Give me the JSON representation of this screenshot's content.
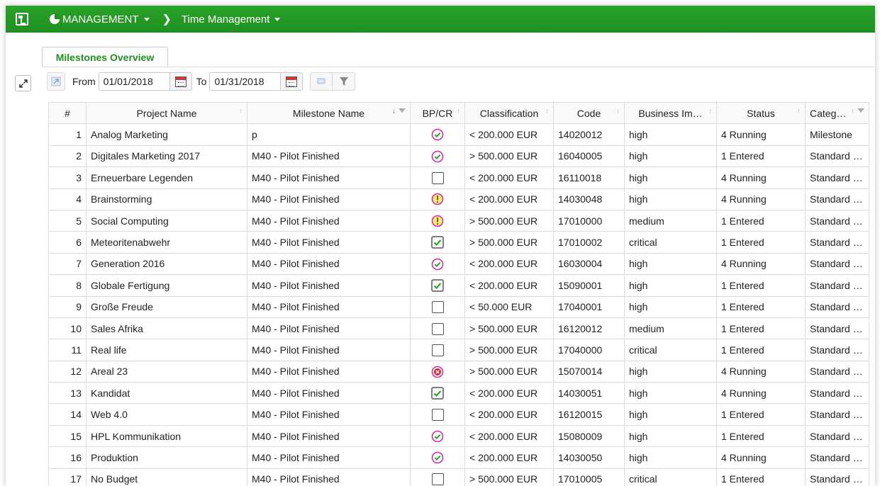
{
  "nav": {
    "management_label": "MANAGEMENT",
    "time_management_label": "Time Management"
  },
  "tab": {
    "label": "Milestones Overview"
  },
  "toolbar": {
    "from_label": "From",
    "from_value": "01/01/2018",
    "to_label": "To",
    "to_value": "01/31/2018"
  },
  "colors": {
    "accent": "#1f8f1f",
    "ok": "#d42ea6",
    "check": "#2aa52a",
    "warn": "#e0b400",
    "error": "#d42020"
  },
  "table": {
    "columns": [
      "#",
      "Project Name",
      "Milestone Name",
      "BP/CR",
      "Classification",
      "Code",
      "Business Im…",
      "Status",
      "Categ…"
    ],
    "rows": [
      {
        "n": "1",
        "project": "Analog Marketing",
        "milestone": "p",
        "bpcr": "circle-check",
        "class": "< 200.000 EUR",
        "code": "14020012",
        "impact": "high",
        "status": "4 Running",
        "cat": "Milestone"
      },
      {
        "n": "2",
        "project": "Digitales Marketing 2017",
        "milestone": "M40 - Pilot Finished",
        "bpcr": "circle-check",
        "class": "> 500.000 EUR",
        "code": "16040005",
        "impact": "high",
        "status": "1 Entered",
        "cat": "Standard …"
      },
      {
        "n": "3",
        "project": "Erneuerbare Legenden",
        "milestone": "M40 - Pilot Finished",
        "bpcr": "empty",
        "class": "< 200.000 EUR",
        "code": "16110018",
        "impact": "high",
        "status": "4 Running",
        "cat": "Standard …"
      },
      {
        "n": "4",
        "project": "Brainstorming",
        "milestone": "M40 - Pilot Finished",
        "bpcr": "warning",
        "class": "< 200.000 EUR",
        "code": "14030048",
        "impact": "high",
        "status": "4 Running",
        "cat": "Standard …"
      },
      {
        "n": "5",
        "project": "Social Computing",
        "milestone": "M40 - Pilot Finished",
        "bpcr": "warning",
        "class": "> 500.000 EUR",
        "code": "17010000",
        "impact": "medium",
        "status": "1 Entered",
        "cat": "Standard …"
      },
      {
        "n": "6",
        "project": "Meteoritenabwehr",
        "milestone": "M40 - Pilot Finished",
        "bpcr": "checkbox",
        "class": "> 500.000 EUR",
        "code": "17010002",
        "impact": "critical",
        "status": "1 Entered",
        "cat": "Standard …"
      },
      {
        "n": "7",
        "project": "Generation 2016",
        "milestone": "M40 - Pilot Finished",
        "bpcr": "circle-check",
        "class": "< 200.000 EUR",
        "code": "16030004",
        "impact": "high",
        "status": "4 Running",
        "cat": "Standard …"
      },
      {
        "n": "8",
        "project": "Globale Fertigung",
        "milestone": "M40 - Pilot Finished",
        "bpcr": "checkbox",
        "class": "< 200.000 EUR",
        "code": "15090001",
        "impact": "high",
        "status": "1 Entered",
        "cat": "Standard …"
      },
      {
        "n": "9",
        "project": "Große Freude",
        "milestone": "M40 - Pilot Finished",
        "bpcr": "empty",
        "class": "< 50.000 EUR",
        "code": "17040001",
        "impact": "high",
        "status": "1 Entered",
        "cat": "Standard …"
      },
      {
        "n": "10",
        "project": "Sales Afrika",
        "milestone": "M40 - Pilot Finished",
        "bpcr": "empty",
        "class": "> 500.000 EUR",
        "code": "16120012",
        "impact": "medium",
        "status": "1 Entered",
        "cat": "Standard …"
      },
      {
        "n": "11",
        "project": "Real life",
        "milestone": "M40 - Pilot Finished",
        "bpcr": "empty",
        "class": "> 500.000 EUR",
        "code": "17040000",
        "impact": "critical",
        "status": "1 Entered",
        "cat": "Standard …"
      },
      {
        "n": "12",
        "project": "Areal 23",
        "milestone": "M40 - Pilot Finished",
        "bpcr": "error",
        "class": "> 500.000 EUR",
        "code": "15070014",
        "impact": "high",
        "status": "4 Running",
        "cat": "Standard …"
      },
      {
        "n": "13",
        "project": "Kandidat",
        "milestone": "M40 - Pilot Finished",
        "bpcr": "checkbox",
        "class": "< 200.000 EUR",
        "code": "14030051",
        "impact": "high",
        "status": "4 Running",
        "cat": "Standard …"
      },
      {
        "n": "14",
        "project": "Web 4.0",
        "milestone": "M40 - Pilot Finished",
        "bpcr": "empty",
        "class": "< 200.000 EUR",
        "code": "16120015",
        "impact": "high",
        "status": "1 Entered",
        "cat": "Standard …"
      },
      {
        "n": "15",
        "project": "HPL Kommunikation",
        "milestone": "M40 - Pilot Finished",
        "bpcr": "circle-check",
        "class": "< 200.000 EUR",
        "code": "15080009",
        "impact": "high",
        "status": "1 Entered",
        "cat": "Standard …"
      },
      {
        "n": "16",
        "project": "Produktion",
        "milestone": "M40 - Pilot Finished",
        "bpcr": "circle-check",
        "class": "< 200.000 EUR",
        "code": "14030050",
        "impact": "high",
        "status": "4 Running",
        "cat": "Standard …"
      },
      {
        "n": "17",
        "project": "No Budget",
        "milestone": "M40 - Pilot Finished",
        "bpcr": "empty",
        "class": "> 500.000 EUR",
        "code": "17010005",
        "impact": "critical",
        "status": "1 Entered",
        "cat": "Standard …"
      }
    ]
  }
}
